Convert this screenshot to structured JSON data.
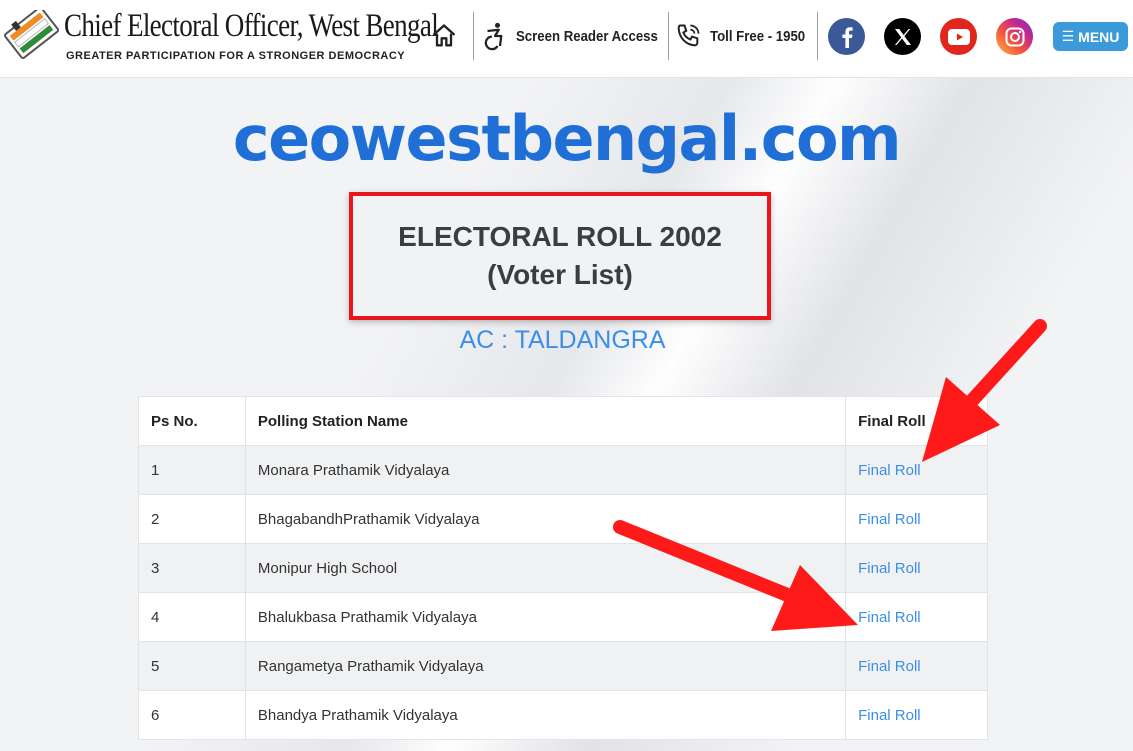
{
  "header": {
    "site_name": "Chief Electoral Officer, West Bengal",
    "tagline": "GREATER PARTICIPATION FOR A STRONGER DEMOCRACY",
    "screen_reader": "Screen Reader Access",
    "toll_free": "Toll Free - 1950",
    "menu_label": "MENU",
    "icons": [
      "home-icon",
      "accessibility-icon",
      "phone-icon",
      "facebook-icon",
      "x-icon",
      "youtube-icon",
      "instagram-icon",
      "hamburger-icon"
    ],
    "colors": {
      "facebook": "#3b5998",
      "x": "#000000",
      "youtube": "#e3261d",
      "menu": "#3b9ad9"
    }
  },
  "brand": "ceowestbengal.com",
  "title": {
    "line1": "ELECTORAL ROLL 2002",
    "line2": "(Voter List)"
  },
  "ac_label": "AC : TALDANGRA",
  "table": {
    "headers": [
      "Ps No.",
      "Polling Station Name",
      "Final Roll"
    ],
    "rows": [
      {
        "ps": "1",
        "name": "Monara Prathamik Vidyalaya",
        "roll": "Final Roll"
      },
      {
        "ps": "2",
        "name": "BhagabandhPrathamik Vidyalaya",
        "roll": "Final Roll"
      },
      {
        "ps": "3",
        "name": "Monipur High School",
        "roll": "Final Roll"
      },
      {
        "ps": "4",
        "name": "Bhalukbasa Prathamik Vidyalaya",
        "roll": "Final Roll"
      },
      {
        "ps": "5",
        "name": "Rangametya Prathamik Vidyalaya",
        "roll": "Final Roll"
      },
      {
        "ps": "6",
        "name": "Bhandya Prathamik Vidyalaya",
        "roll": "Final Roll"
      }
    ]
  },
  "accent_colors": {
    "link": "#3d8ee6",
    "highlight": "#e8161d",
    "brand": "#1f6fd6"
  }
}
